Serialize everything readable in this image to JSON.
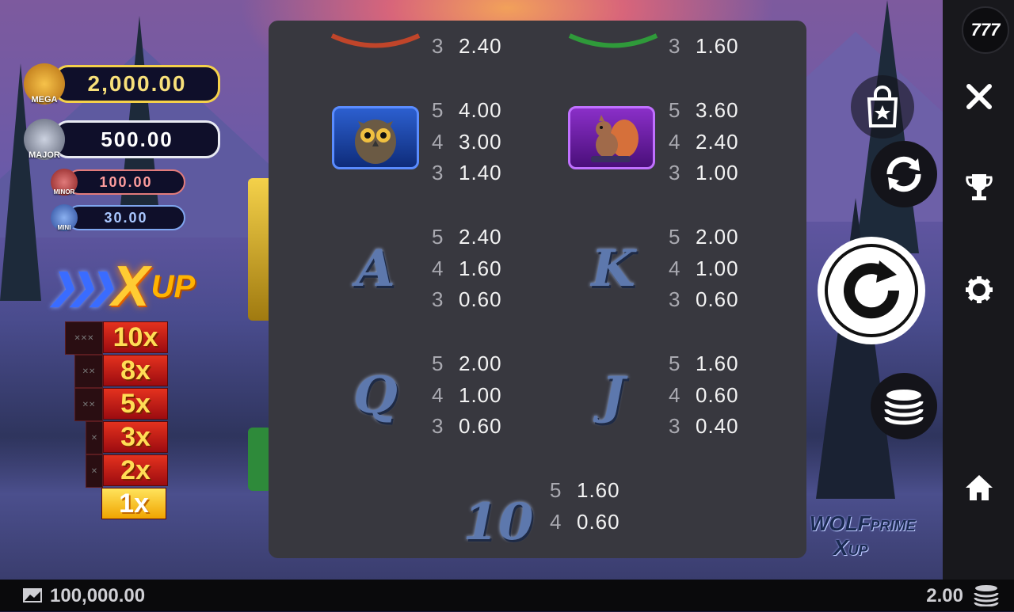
{
  "jackpots": {
    "mega": {
      "label": "MEGA",
      "value": "2,000.00"
    },
    "major": {
      "label": "MAJOR",
      "value": "500.00"
    },
    "minor": {
      "label": "MINOR",
      "value": "100.00"
    },
    "mini": {
      "label": "MINI",
      "value": "30.00"
    }
  },
  "xup_logo": {
    "text_x": "X",
    "text_up": "UP"
  },
  "multipliers": [
    "10x",
    "8x",
    "5x",
    "3x",
    "2x",
    "1x"
  ],
  "active_multiplier": "1x",
  "paytable": {
    "top_partial": [
      {
        "count": "3",
        "amount": "2.40",
        "symbol_color": "#c0452a"
      },
      {
        "count": "3",
        "amount": "1.60",
        "symbol_color": "#2f9a3a"
      }
    ],
    "rows": [
      [
        {
          "symbol": "owl",
          "icon": "owl-icon",
          "pays": [
            {
              "count": "5",
              "amount": "4.00"
            },
            {
              "count": "4",
              "amount": "3.00"
            },
            {
              "count": "3",
              "amount": "1.40"
            }
          ]
        },
        {
          "symbol": "squirrel",
          "icon": "squirrel-icon",
          "pays": [
            {
              "count": "5",
              "amount": "3.60"
            },
            {
              "count": "4",
              "amount": "2.40"
            },
            {
              "count": "3",
              "amount": "1.00"
            }
          ]
        }
      ],
      [
        {
          "symbol": "A",
          "icon": "letter-a-icon",
          "pays": [
            {
              "count": "5",
              "amount": "2.40"
            },
            {
              "count": "4",
              "amount": "1.60"
            },
            {
              "count": "3",
              "amount": "0.60"
            }
          ]
        },
        {
          "symbol": "K",
          "icon": "letter-k-icon",
          "pays": [
            {
              "count": "5",
              "amount": "2.00"
            },
            {
              "count": "4",
              "amount": "1.00"
            },
            {
              "count": "3",
              "amount": "0.60"
            }
          ]
        }
      ],
      [
        {
          "symbol": "Q",
          "icon": "letter-q-icon",
          "pays": [
            {
              "count": "5",
              "amount": "2.00"
            },
            {
              "count": "4",
              "amount": "1.00"
            },
            {
              "count": "3",
              "amount": "0.60"
            }
          ]
        },
        {
          "symbol": "J",
          "icon": "letter-j-icon",
          "pays": [
            {
              "count": "5",
              "amount": "1.60"
            },
            {
              "count": "4",
              "amount": "0.60"
            },
            {
              "count": "3",
              "amount": "0.40"
            }
          ]
        }
      ]
    ],
    "last": {
      "symbol": "10",
      "icon": "number-ten-icon",
      "pays": [
        {
          "count": "5",
          "amount": "1.60"
        },
        {
          "count": "4",
          "amount": "0.60"
        }
      ]
    }
  },
  "sidebar": {
    "logo_text": "777",
    "icons": [
      "close-icon",
      "trophy-icon",
      "settings-icon",
      "home-icon"
    ]
  },
  "controls": [
    "buy-feature-icon",
    "autoplay-icon",
    "spin-icon",
    "bet-coins-icon"
  ],
  "game_logo": {
    "line1": "WOLF",
    "line2": "PRIME",
    "line3": "X",
    "line4": "UP"
  },
  "bottom_bar": {
    "balance": "100,000.00",
    "bet": "2.00"
  },
  "colors": {
    "panel": "#38383f",
    "accent_gold": "#f4d14a",
    "sidebar": "#18181c"
  }
}
